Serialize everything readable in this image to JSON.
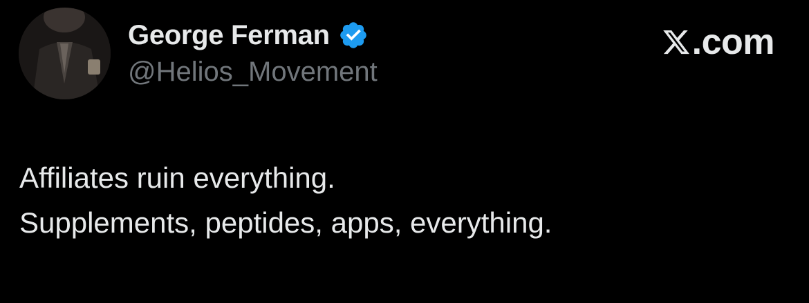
{
  "author": {
    "display_name": "George Ferman",
    "handle": "@Helios_Movement",
    "verified": true
  },
  "brand": {
    "logo_icon": "x-logo-icon",
    "text": ".com"
  },
  "tweet": {
    "lines": [
      "Affiliates ruin everything.",
      "Supplements, peptides, apps, everything."
    ]
  },
  "colors": {
    "background": "#000000",
    "text": "#e7e9ea",
    "secondary_text": "#71767b",
    "verified_badge": "#1d9bf0"
  }
}
